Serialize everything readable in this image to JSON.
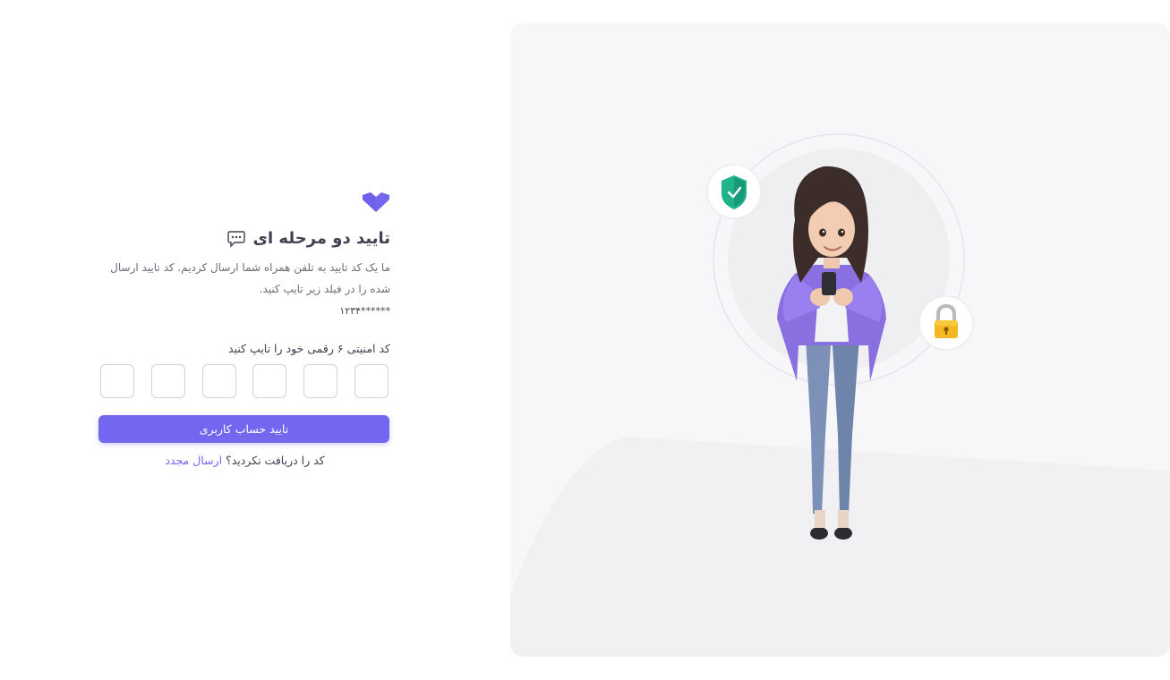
{
  "auth": {
    "title": "تایید دو مرحله ای",
    "description": "ما یک کد تایید به تلفن همراه شما ارسال کردیم. کد تایید ارسال شده را در فیلد زیر تایپ کنید.",
    "masked_phone": "******۱۲۳۴",
    "code_label": "کد امنیتی ۶ رقمی خود را تایپ کنید",
    "otp_digits": [
      "",
      "",
      "",
      "",
      "",
      ""
    ],
    "submit_label": "تایید حساب کاربری",
    "resend_prompt": "کد را دریافت نکردید؟",
    "resend_link": "ارسال مجدد"
  },
  "colors": {
    "primary": "#7367f0",
    "heading": "#444050",
    "body_text": "#6d6b77",
    "panel_bg": "#f7f7f9"
  },
  "icons": {
    "logo": "brand-logo-icon",
    "title_icon": "chat-bubble-icon",
    "illustration": "woman-with-phone-illustration",
    "shield": "shield-check-icon",
    "lock": "padlock-icon"
  }
}
